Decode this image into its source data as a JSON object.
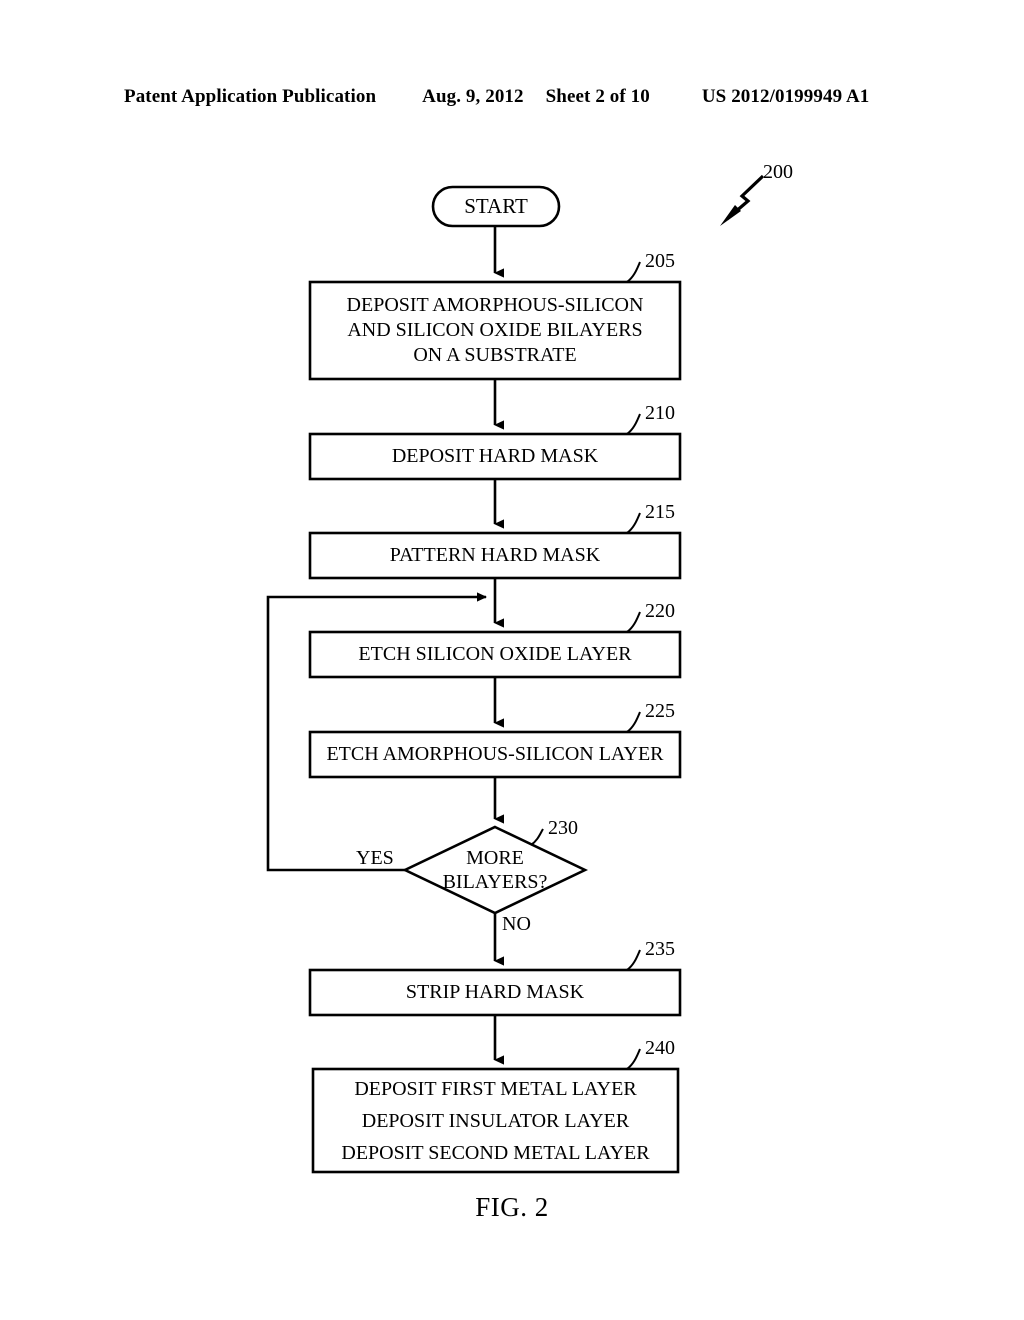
{
  "header": {
    "publication": "Patent Application Publication",
    "date": "Aug. 9, 2012",
    "sheet": "Sheet 2 of 10",
    "patent_number": "US 2012/0199949 A1"
  },
  "figure": {
    "caption": "FIG. 2",
    "diagram_ref": "200",
    "start_label": "START",
    "branch_yes": "YES",
    "branch_no": "NO",
    "nodes": [
      {
        "ref": "205",
        "text": "DEPOSIT AMORPHOUS-SILICON\nAND SILICON OXIDE BILAYERS\nON A SUBSTRATE",
        "shape": "process"
      },
      {
        "ref": "210",
        "text": "DEPOSIT HARD MASK",
        "shape": "process"
      },
      {
        "ref": "215",
        "text": "PATTERN HARD MASK",
        "shape": "process"
      },
      {
        "ref": "220",
        "text": "ETCH SILICON OXIDE LAYER",
        "shape": "process"
      },
      {
        "ref": "225",
        "text": "ETCH AMORPHOUS-SILICON LAYER",
        "shape": "process"
      },
      {
        "ref": "230",
        "text": "MORE\nBILAYERS?",
        "shape": "decision"
      },
      {
        "ref": "235",
        "text": "STRIP HARD MASK",
        "shape": "process"
      },
      {
        "ref": "240",
        "text": "DEPOSIT FIRST METAL LAYER\nDEPOSIT INSULATOR LAYER\nDEPOSIT SECOND METAL LAYER",
        "shape": "process"
      }
    ]
  },
  "colors": {
    "ink": "#000000",
    "paper": "#ffffff"
  }
}
